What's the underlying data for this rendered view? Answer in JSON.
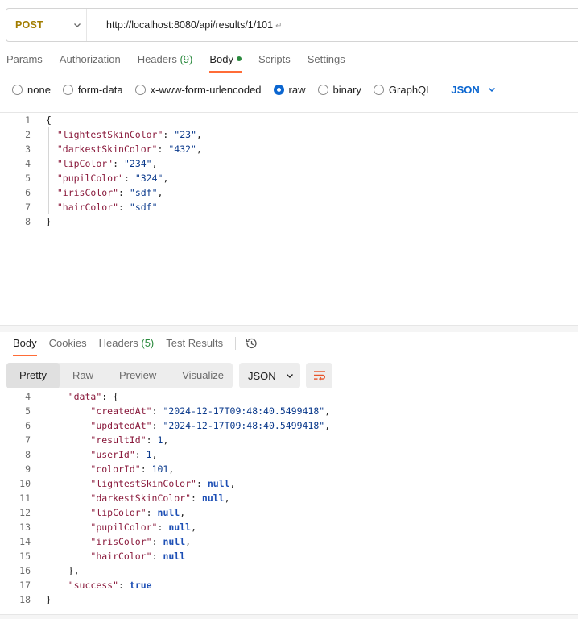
{
  "request": {
    "method": "POST",
    "url": "http://localhost:8080/api/results/1/101",
    "url_suffix": "↵"
  },
  "request_tabs": [
    {
      "label": "Params",
      "count": ""
    },
    {
      "label": "Authorization",
      "count": ""
    },
    {
      "label": "Headers",
      "count": "(9)"
    },
    {
      "label": "Body",
      "count": ""
    },
    {
      "label": "Scripts",
      "count": ""
    },
    {
      "label": "Settings",
      "count": ""
    }
  ],
  "active_request_tab": "Body",
  "body_types": [
    "none",
    "form-data",
    "x-www-form-urlencoded",
    "raw",
    "binary",
    "GraphQL"
  ],
  "selected_body_type": "raw",
  "body_language": "JSON",
  "request_body_lines": [
    {
      "n": "1",
      "text": "{"
    },
    {
      "n": "2",
      "text": "  \"lightestSkinColor\": \"23\","
    },
    {
      "n": "3",
      "text": "  \"darkestSkinColor\": \"432\","
    },
    {
      "n": "4",
      "text": "  \"lipColor\": \"234\","
    },
    {
      "n": "5",
      "text": "  \"pupilColor\": \"324\","
    },
    {
      "n": "6",
      "text": "  \"irisColor\": \"sdf\","
    },
    {
      "n": "7",
      "text": "  \"hairColor\": \"sdf\""
    },
    {
      "n": "8",
      "text": "}"
    }
  ],
  "response_tabs": [
    {
      "label": "Body",
      "count": ""
    },
    {
      "label": "Cookies",
      "count": ""
    },
    {
      "label": "Headers",
      "count": "(5)"
    },
    {
      "label": "Test Results",
      "count": ""
    }
  ],
  "active_response_tab": "Body",
  "view_modes": [
    "Pretty",
    "Raw",
    "Preview",
    "Visualize"
  ],
  "active_view_mode": "Pretty",
  "response_format": "JSON",
  "response_body_lines": [
    {
      "n": "4",
      "text": "    \"data\": {"
    },
    {
      "n": "5",
      "text": "        \"createdAt\": \"2024-12-17T09:48:40.5499418\","
    },
    {
      "n": "6",
      "text": "        \"updatedAt\": \"2024-12-17T09:48:40.5499418\","
    },
    {
      "n": "7",
      "text": "        \"resultId\": 1,"
    },
    {
      "n": "8",
      "text": "        \"userId\": 1,"
    },
    {
      "n": "9",
      "text": "        \"colorId\": 101,"
    },
    {
      "n": "10",
      "text": "        \"lightestSkinColor\": null,"
    },
    {
      "n": "11",
      "text": "        \"darkestSkinColor\": null,"
    },
    {
      "n": "12",
      "text": "        \"lipColor\": null,"
    },
    {
      "n": "13",
      "text": "        \"pupilColor\": null,"
    },
    {
      "n": "14",
      "text": "        \"irisColor\": null,"
    },
    {
      "n": "15",
      "text": "        \"hairColor\": null"
    },
    {
      "n": "16",
      "text": "    },"
    },
    {
      "n": "17",
      "text": "    \"success\": true"
    },
    {
      "n": "18",
      "text": "}"
    }
  ],
  "colors": {
    "method": "#a27d00",
    "accent": "#ff6c37",
    "link_blue": "#0b66d0",
    "json_key": "#8a1a3c",
    "json_string": "#0b3a8c",
    "json_keyword": "#1d4fb5"
  },
  "icons": {
    "method_dropdown": "chevron-down-icon",
    "language_dropdown": "chevron-down-icon",
    "history": "history-icon",
    "format_dropdown": "chevron-down-icon",
    "wrap": "wrap-lines-icon"
  }
}
